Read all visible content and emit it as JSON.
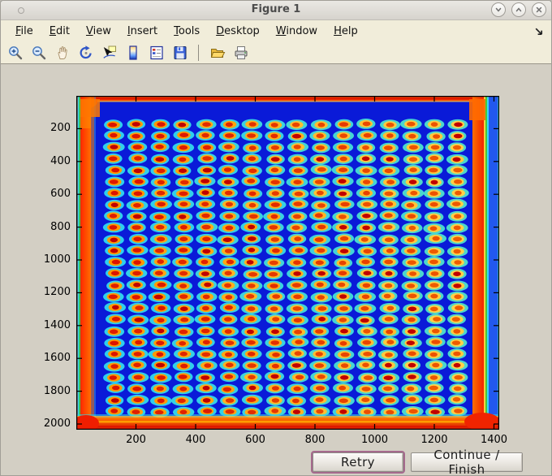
{
  "window": {
    "title": "Figure 1",
    "controls": [
      {
        "name": "minimize-button",
        "icon": "chevron-down-icon"
      },
      {
        "name": "maximize-button",
        "icon": "chevron-up-icon"
      },
      {
        "name": "close-button",
        "icon": "close-icon"
      }
    ]
  },
  "menu": {
    "items": [
      {
        "label": "File"
      },
      {
        "label": "Edit"
      },
      {
        "label": "View"
      },
      {
        "label": "Insert"
      },
      {
        "label": "Tools"
      },
      {
        "label": "Desktop"
      },
      {
        "label": "Window"
      },
      {
        "label": "Help"
      }
    ],
    "dock_icon": "dock-figure-arrow-icon"
  },
  "toolbar": {
    "icons": [
      "zoom-in",
      "zoom-out",
      "pan",
      "rotate-3d",
      "data-cursor",
      "colorbar",
      "legend",
      "save",
      "separator",
      "open-folder",
      "print"
    ]
  },
  "chart_data": {
    "type": "heatmap",
    "title": "",
    "xlabel": "",
    "ylabel": "",
    "x_ticks": [
      200,
      400,
      600,
      800,
      1000,
      1200,
      1400
    ],
    "y_ticks": [
      200,
      400,
      600,
      800,
      1000,
      1200,
      1400,
      1600,
      1800,
      2000
    ],
    "x_range": [
      1,
      1416
    ],
    "y_range": [
      1,
      2035
    ],
    "grid": {
      "columns": 16,
      "rows": 26
    },
    "legend_position": "none",
    "description": "Microarray scan shown with jet colormap: regular grid of hybridization spots (red/orange cores, yellow rings, cyan halos) on a deep blue field, with saturated red/orange bands along all four plate edges",
    "colors": {
      "background": "#0a1ad8",
      "halo_left": "#30d8f0",
      "halo_right": "#52e2c8",
      "ring_left": "#ff9800",
      "ring_right": "#ffd24a",
      "core_left": "#dc1400",
      "core_right": "#f06400",
      "core_dark": "#c00000",
      "edge_red": "#f02800",
      "edge_orange": "#ff7a00",
      "axis": "#000000"
    }
  },
  "dialog": {
    "retry_label": "Retry",
    "continue_label": "Continue / Finish"
  }
}
